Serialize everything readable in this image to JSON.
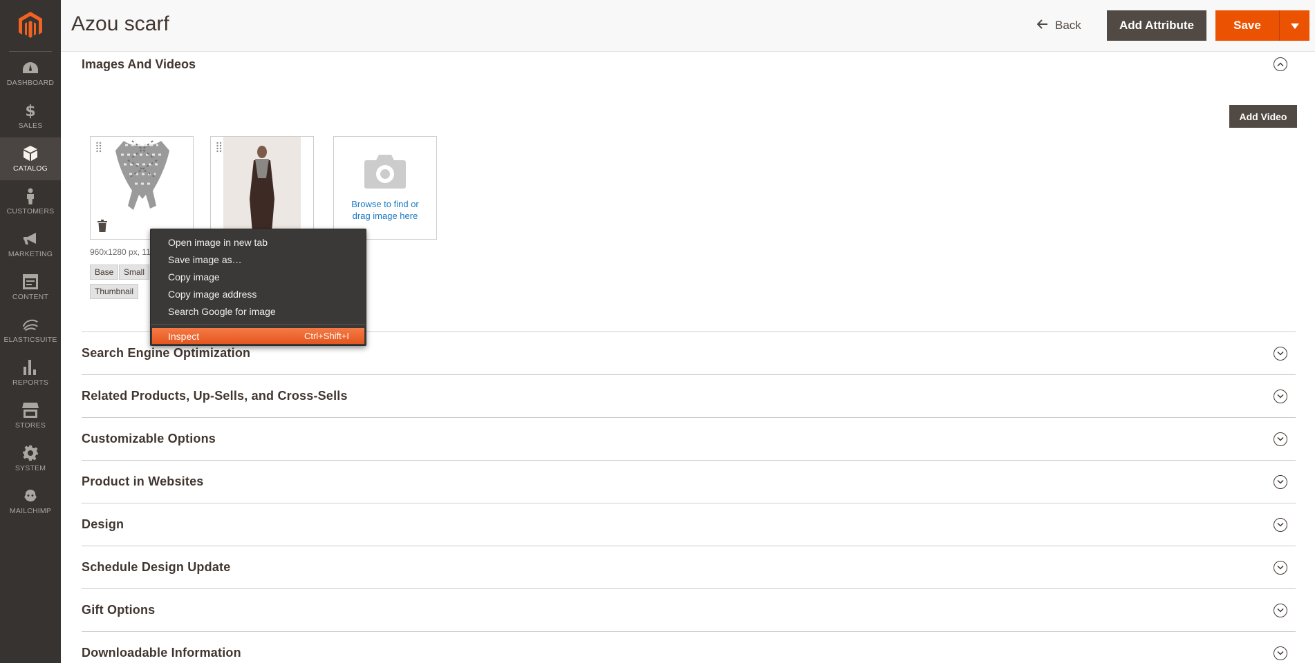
{
  "page": {
    "title": "Azou scarf",
    "back_label": "Back",
    "add_attribute_label": "Add Attribute",
    "save_label": "Save"
  },
  "sidebar": {
    "items": [
      {
        "label": "Dashboard",
        "icon": "dashboard-icon"
      },
      {
        "label": "Sales",
        "icon": "dollar-icon"
      },
      {
        "label": "Catalog",
        "icon": "box-icon",
        "active": true
      },
      {
        "label": "Customers",
        "icon": "person-icon"
      },
      {
        "label": "Marketing",
        "icon": "megaphone-icon"
      },
      {
        "label": "Content",
        "icon": "content-icon"
      },
      {
        "label": "ElasticSuite",
        "icon": "elasticsuite-icon"
      },
      {
        "label": "Reports",
        "icon": "bar-chart-icon"
      },
      {
        "label": "Stores",
        "icon": "store-icon"
      },
      {
        "label": "System",
        "icon": "gear-icon"
      },
      {
        "label": "MailChimp",
        "icon": "mailchimp-icon"
      }
    ]
  },
  "images_section": {
    "title": "Images And Videos",
    "add_video_label": "Add Video",
    "uploader_text": "Browse to find or drag image here",
    "image_meta": "960x1280 px, 11",
    "roles": [
      "Base",
      "Small",
      "Thumbnail"
    ]
  },
  "context_menu": {
    "items": [
      "Open image in new tab",
      "Save image as…",
      "Copy image",
      "Copy image address",
      "Search Google for image"
    ],
    "inspect_label": "Inspect",
    "inspect_shortcut": "Ctrl+Shift+I"
  },
  "sections": [
    "Search Engine Optimization",
    "Related Products, Up-Sells, and Cross-Sells",
    "Customizable Options",
    "Product in Websites",
    "Design",
    "Schedule Design Update",
    "Gift Options",
    "Downloadable Information"
  ],
  "colors": {
    "sidebar_bg": "#373330",
    "accent": "#eb5202",
    "dark_button": "#514943",
    "link": "#1979c3"
  }
}
